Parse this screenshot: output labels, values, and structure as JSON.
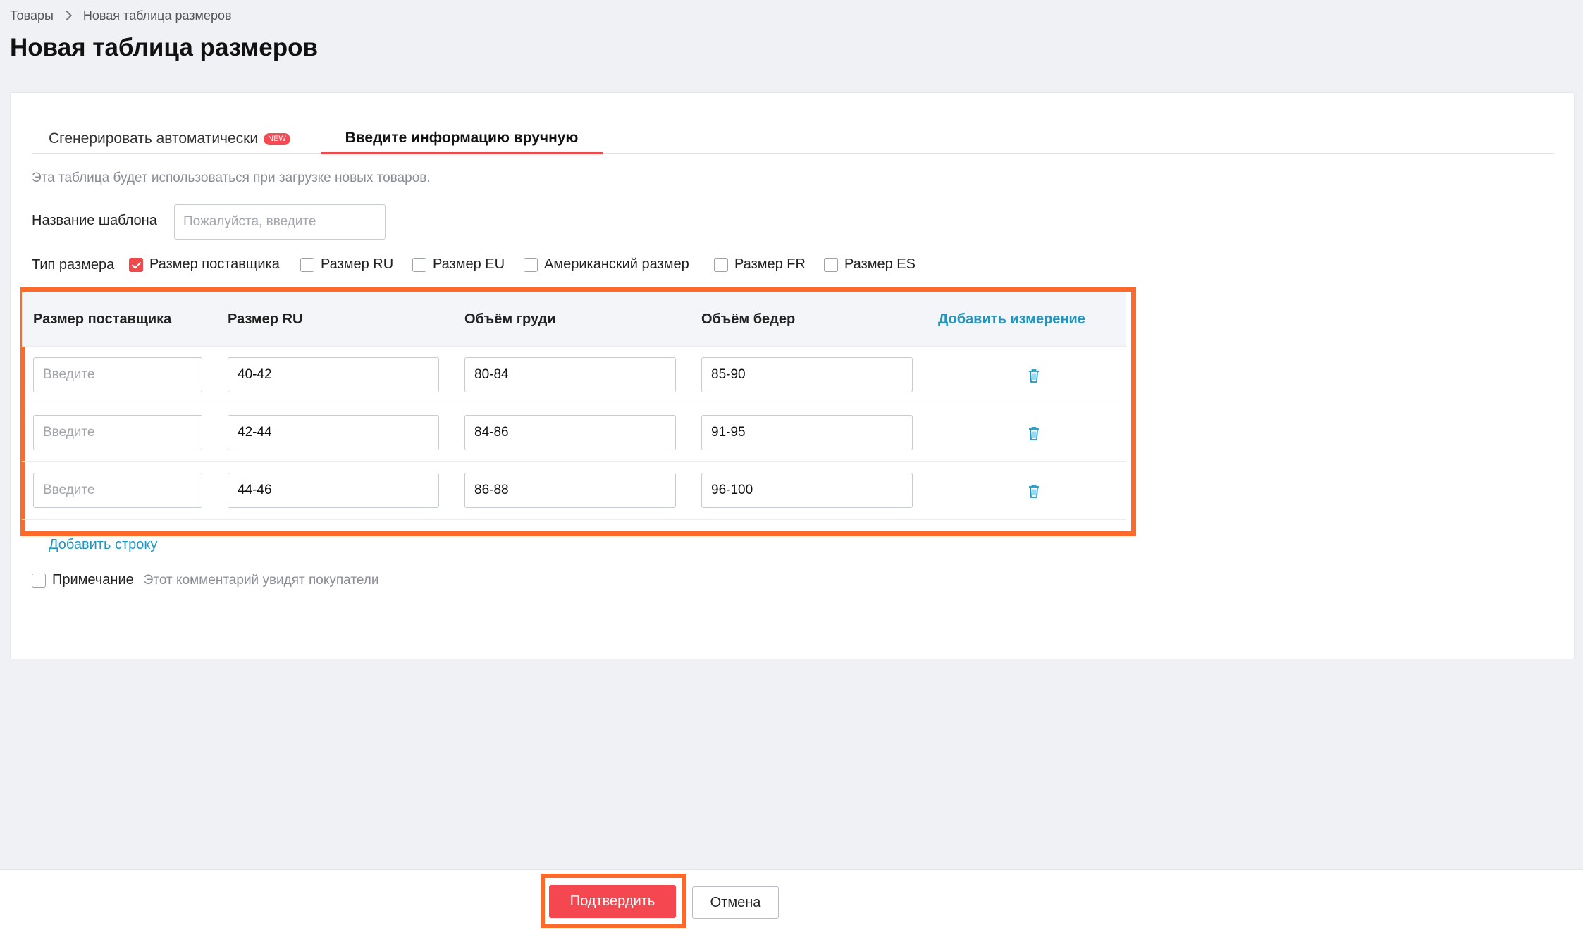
{
  "breadcrumb": {
    "root": "Товары",
    "current": "Новая таблица размеров"
  },
  "page_title": "Новая таблица размеров",
  "tabs": {
    "auto": {
      "label": "Сгенерировать автоматически",
      "badge": "NEW"
    },
    "manual": {
      "label": "Введите информацию вручную",
      "active": true
    }
  },
  "hint": "Эта таблица будет использоваться при загрузке новых товаров.",
  "template_name": {
    "label": "Название шаблона",
    "placeholder": "Пожалуйста, введите",
    "value": ""
  },
  "size_type": {
    "label": "Тип размера",
    "options": [
      {
        "label": "Размер поставщика",
        "checked": true
      },
      {
        "label": "Размер RU",
        "checked": false
      },
      {
        "label": "Размер EU",
        "checked": false
      },
      {
        "label": "Американский размер",
        "checked": false
      },
      {
        "label": "Размер FR",
        "checked": false
      },
      {
        "label": "Размер ES",
        "checked": false
      }
    ]
  },
  "table": {
    "headers": [
      "Размер поставщика",
      "Размер RU",
      "Объём груди",
      "Объём бедер"
    ],
    "add_measure": "Добавить измерение",
    "placeholder": "Введите",
    "rows": [
      {
        "supplier": "",
        "ru": "40-42",
        "chest": "80-84",
        "hips": "85-90"
      },
      {
        "supplier": "",
        "ru": "42-44",
        "chest": "84-86",
        "hips": "91-95"
      },
      {
        "supplier": "",
        "ru": "44-46",
        "chest": "86-88",
        "hips": "96-100"
      }
    ]
  },
  "add_row": "Добавить строку",
  "note": {
    "label": "Примечание",
    "hint": "Этот комментарий увидят покупатели",
    "checked": false
  },
  "footer": {
    "confirm": "Подтвердить",
    "cancel": "Отмена"
  },
  "colors": {
    "accent": "#f0494b",
    "link": "#1f96c0",
    "highlight": "#ff6a2b"
  },
  "icons": {
    "delete": "trash-icon",
    "breadcrumb_separator": "chevron-right-icon"
  }
}
